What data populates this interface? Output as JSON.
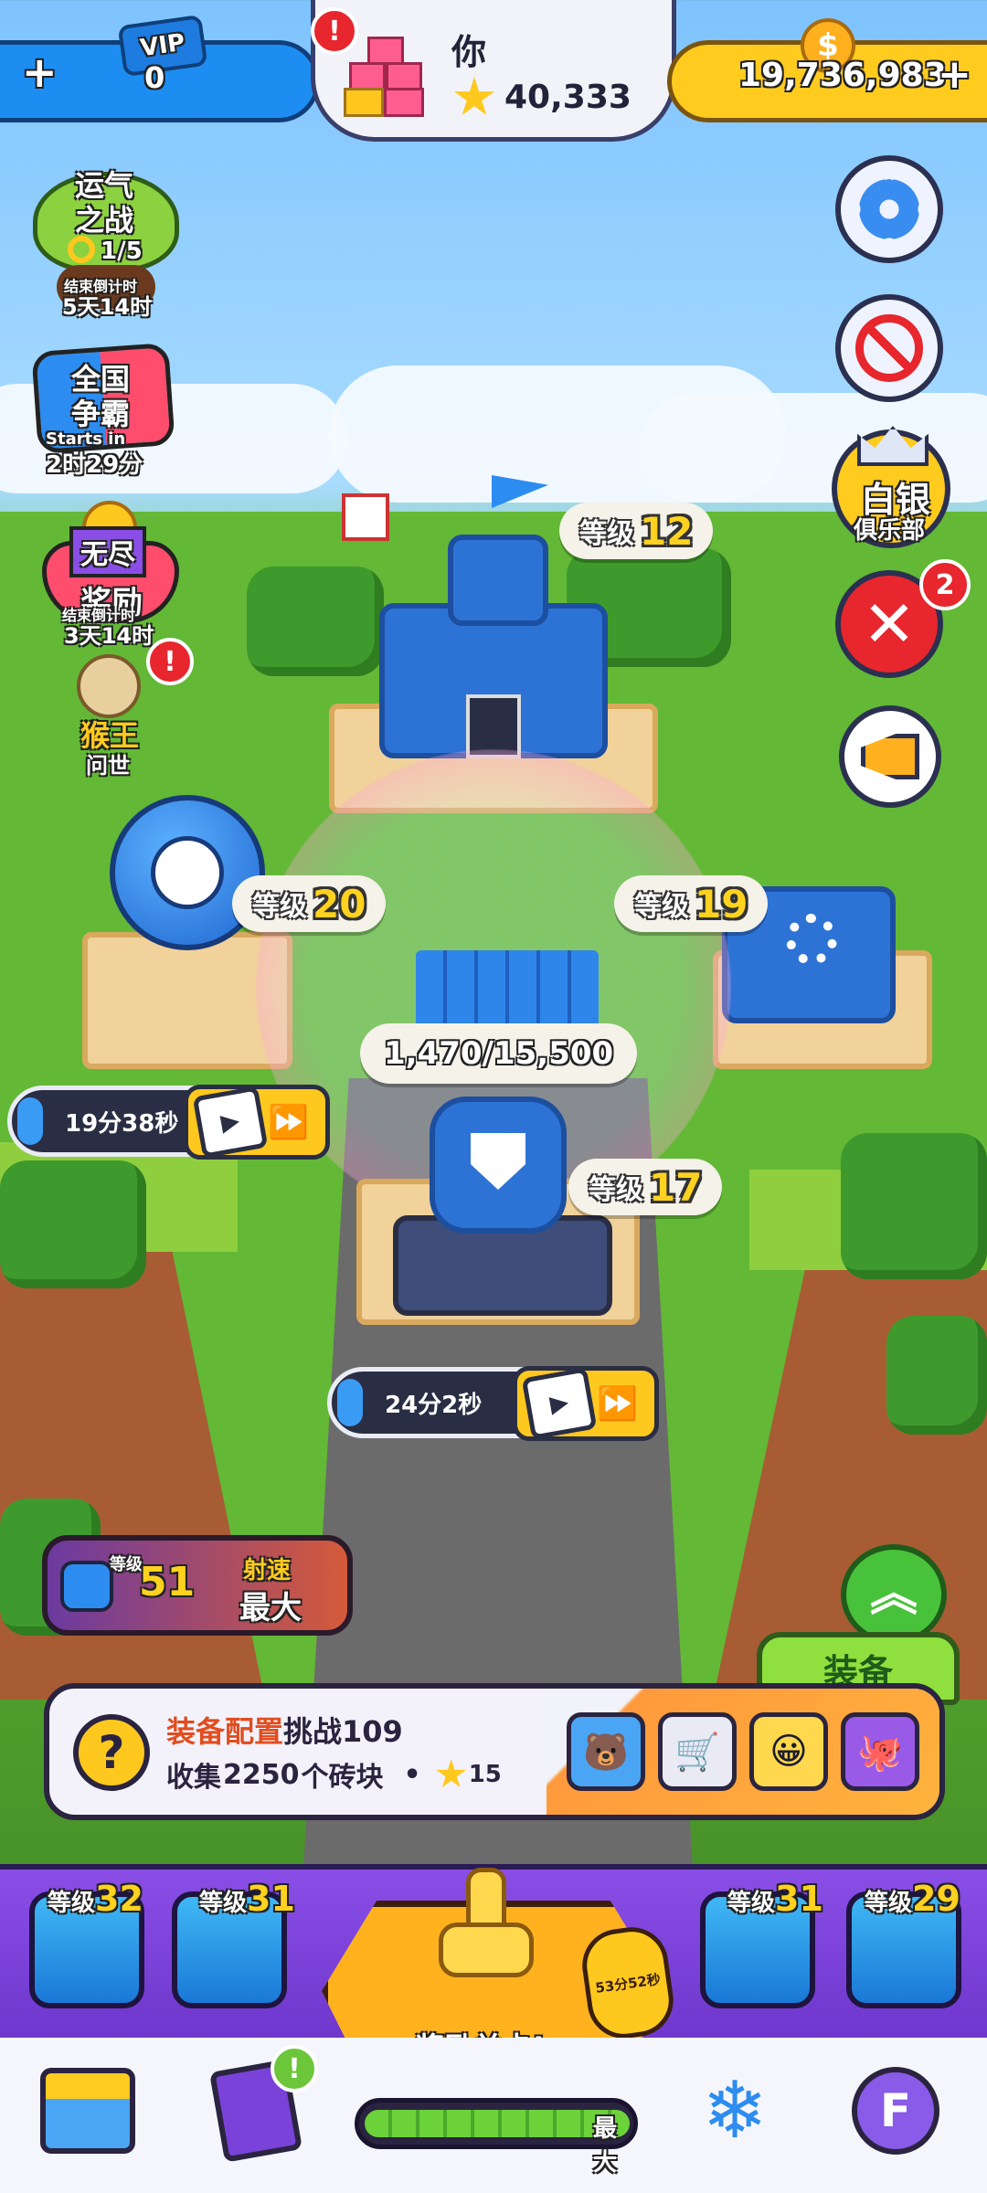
{
  "topbar": {
    "left_plus": "+",
    "vip_label": "VIP",
    "vip_count": "0",
    "alert": "!",
    "player_name": "你",
    "stars": "40,333",
    "coins": "19,736,983",
    "coins_plus": "+"
  },
  "events": {
    "luck_war": {
      "title_line1": "运气",
      "title_line2": "之战",
      "progress": "1/5",
      "countdown_label": "结束倒计时",
      "countdown": "5天14时"
    },
    "national": {
      "title_line1": "全国",
      "title_line2": "争霸",
      "starts_label": "Starts in",
      "starts_time": "2时29分"
    },
    "reward": {
      "tag": "无尽",
      "title": "奖励",
      "countdown_label": "结束倒计时",
      "countdown": "3天14时"
    },
    "monkey": {
      "title": "猴王",
      "subtitle": "问世",
      "alert": "!"
    }
  },
  "side": {
    "club_title": "白银",
    "club_sub": "俱乐部",
    "battle_badge": "2"
  },
  "buildings": {
    "hq": {
      "level_label": "等级",
      "level": "12"
    },
    "balloon": {
      "level_label": "等级",
      "level": "20",
      "timer": "19分38秒"
    },
    "factory": {
      "level_label": "等级",
      "level": "19"
    },
    "tower": {
      "level_label": "等级",
      "level": "17",
      "timer": "24分2秒",
      "progress": "1,470/15,500"
    }
  },
  "fire_rate": {
    "level_label": "等级",
    "level": "51",
    "label": "射速",
    "value": "最大"
  },
  "equip_tab": "装备",
  "mission": {
    "icon": "?",
    "title_hl": "装备配置",
    "title_rest": "挑战109",
    "desc_pre": "收集",
    "desc_num": "2250",
    "desc_post": "个砖块",
    "bullet": "•",
    "reward": "15"
  },
  "weapons": [
    {
      "label": "等级",
      "level": "32"
    },
    {
      "label": "等级",
      "level": "31"
    },
    {
      "label": "等级",
      "level": "31"
    },
    {
      "label": "等级",
      "level": "29"
    }
  ],
  "reward_level": {
    "label": "奖励关卡!",
    "timer": "53分52秒",
    "meter_label": "最大"
  },
  "nav": {
    "cards_alert": "!"
  },
  "colors": {
    "accent_blue": "#1d8df2",
    "coin_yellow": "#ffcb1e",
    "panel_purple": "#7a42d8",
    "reward_orange": "#ffb21e"
  }
}
